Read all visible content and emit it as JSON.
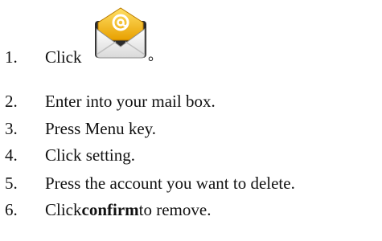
{
  "steps": [
    {
      "num": "1.",
      "before": "Click",
      "after": "。"
    },
    {
      "num": "2.",
      "text": "Enter into your mail box."
    },
    {
      "num": "3.",
      "text": "Press Menu key."
    },
    {
      "num": "4.",
      "text": "Click setting."
    },
    {
      "num": "5.",
      "text": "Press the account you want to delete."
    },
    {
      "num": "6.",
      "before": "Click ",
      "bold": "confirm",
      "after": " to remove."
    }
  ],
  "icon": {
    "name": "email-app-icon",
    "accent": "#f2b51a",
    "accent_dark": "#b97a00",
    "paper": "#ffffff"
  }
}
